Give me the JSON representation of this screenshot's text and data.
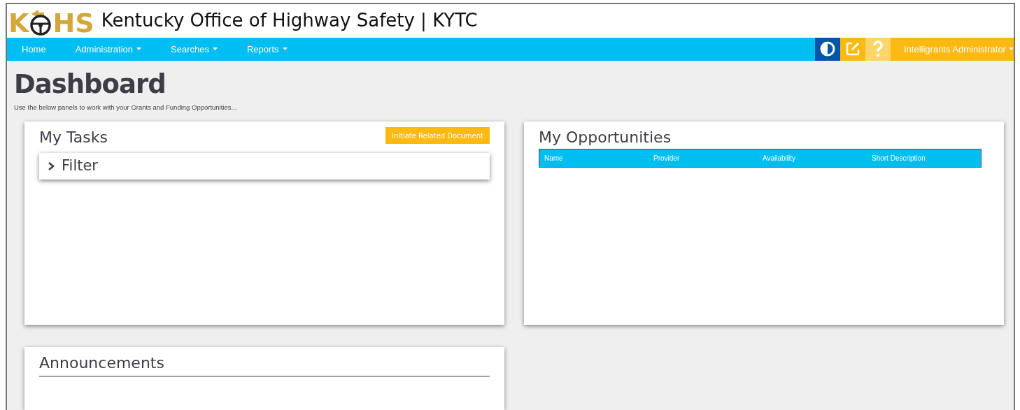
{
  "header": {
    "logo_letters": [
      "K",
      "HS"
    ],
    "title": "Kentucky Office of Highway Safety | KYTC"
  },
  "nav": {
    "items": [
      {
        "label": "Home",
        "dropdown": false
      },
      {
        "label": "Administration",
        "dropdown": true
      },
      {
        "label": "Searches",
        "dropdown": true
      },
      {
        "label": "Reports",
        "dropdown": true
      }
    ],
    "user": {
      "label": "Intelligrants Administrator",
      "dropdown": true
    }
  },
  "page": {
    "title": "Dashboard",
    "subtitle": "Use the below panels to work with your Grants and Funding Opportunities..."
  },
  "tasks": {
    "title": "My Tasks",
    "button": "Initiate Related Document",
    "filter": {
      "label": "Filter",
      "expanded": false
    }
  },
  "opportunities": {
    "title": "My Opportunities",
    "columns": [
      "Name",
      "Provider",
      "Availability",
      "Short Description"
    ]
  },
  "announcements": {
    "title": "Announcements"
  }
}
